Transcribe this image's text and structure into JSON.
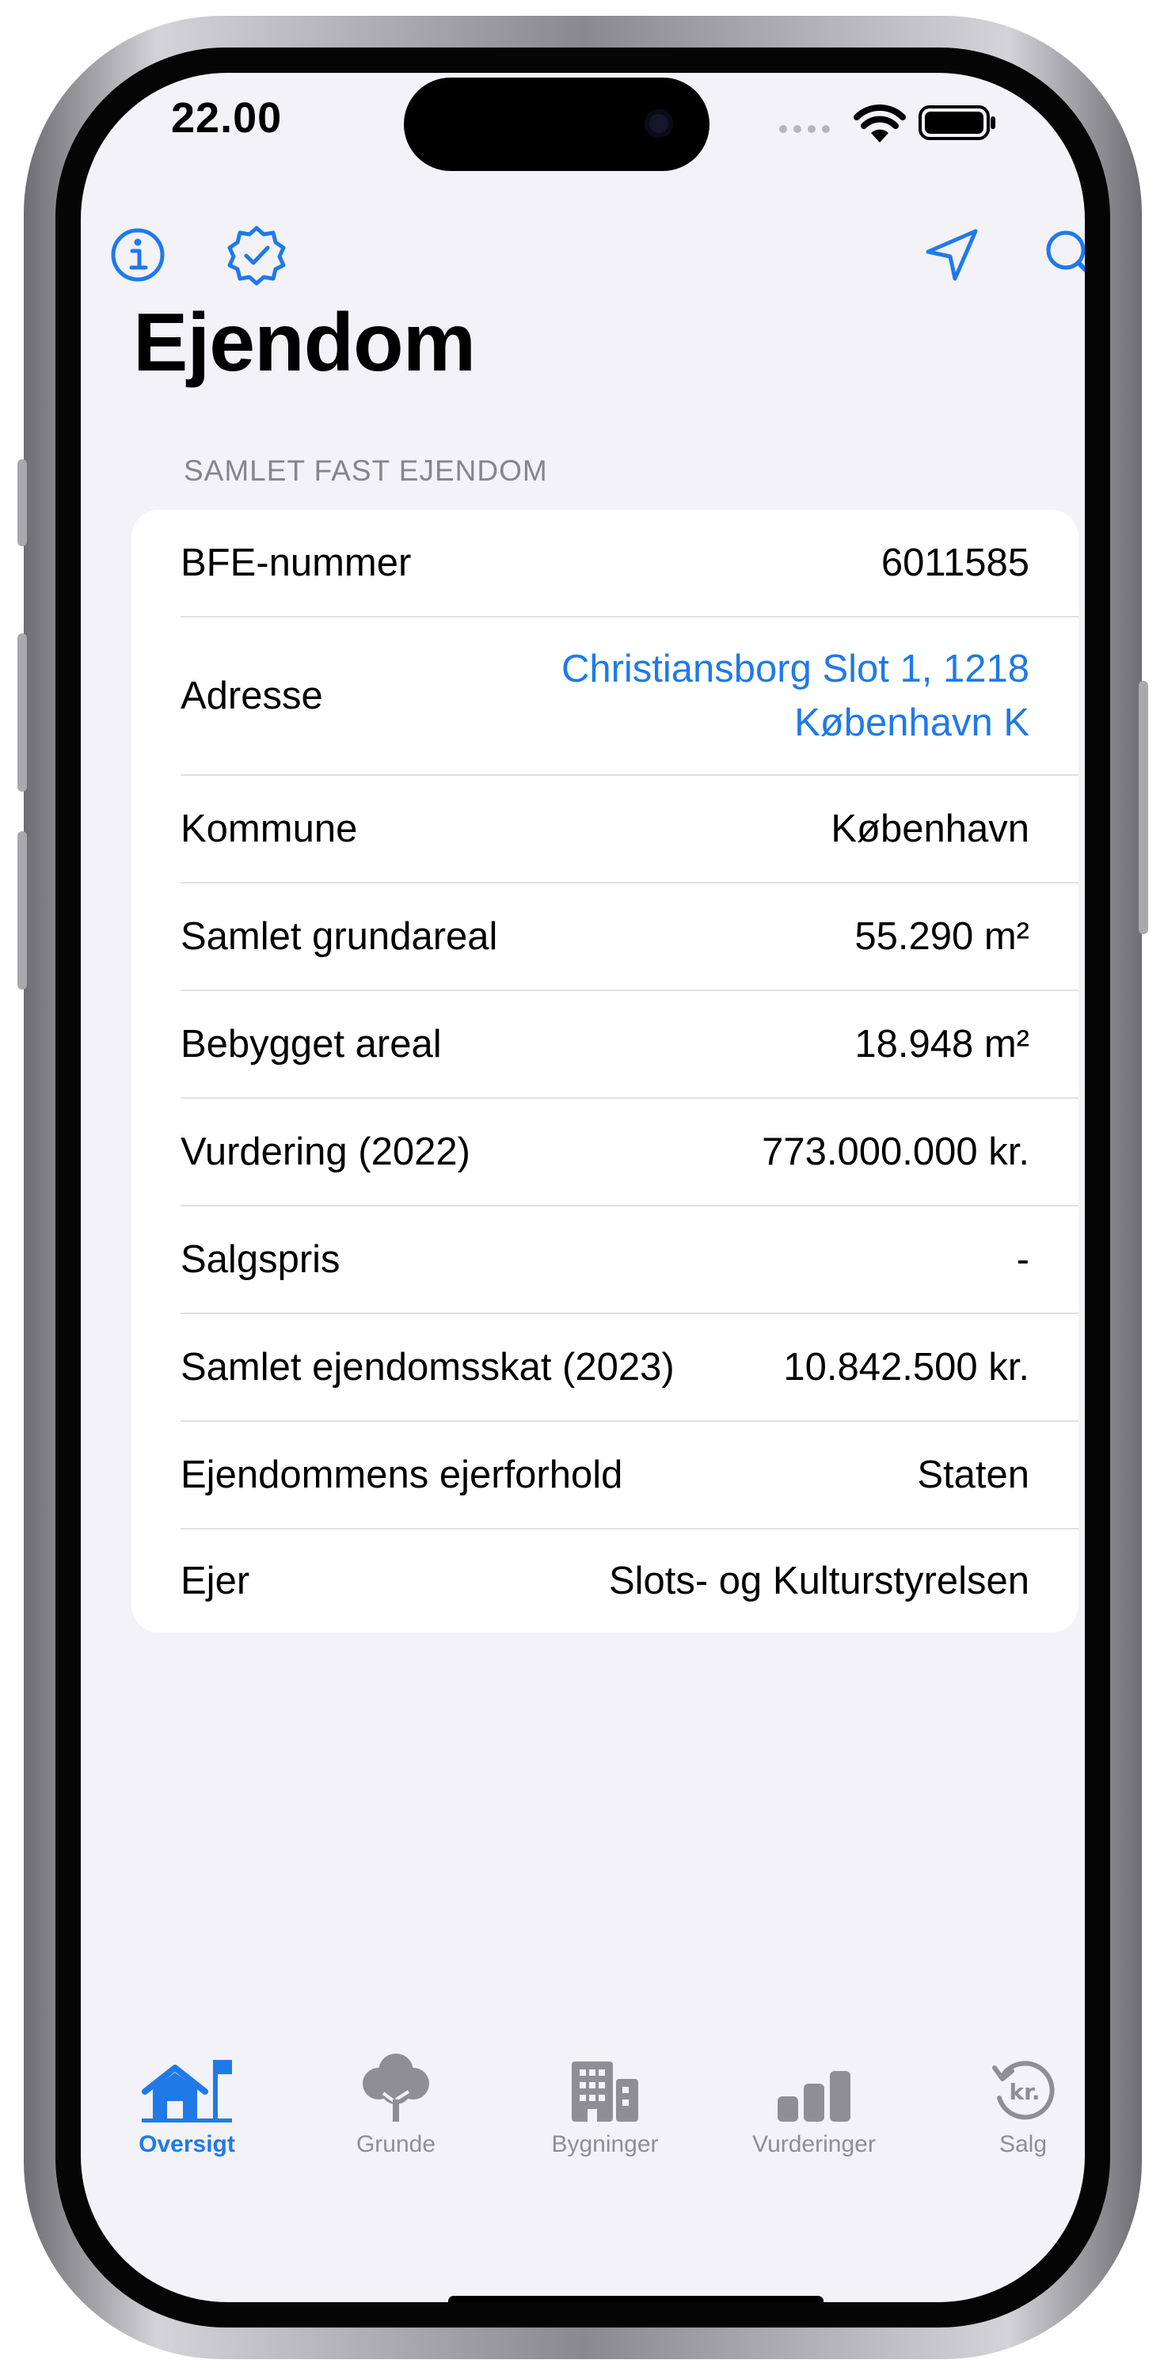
{
  "status_bar": {
    "time": "22.00"
  },
  "toolbar": {
    "left_icons": [
      "info-icon",
      "verified-badge-icon"
    ],
    "right_icons": [
      "location-arrow-icon",
      "search-icon"
    ]
  },
  "page": {
    "title": "Ejendom",
    "section_header": "SAMLET FAST EJENDOM"
  },
  "properties": [
    {
      "label": "BFE-nummer",
      "value": "6011585"
    },
    {
      "label": "Adresse",
      "value_line1": "Christiansborg Slot 1, 1218",
      "value_line2": "København K"
    },
    {
      "label": "Kommune",
      "value": "København"
    },
    {
      "label": "Samlet grundareal",
      "value": "55.290 m²"
    },
    {
      "label": "Bebygget areal",
      "value": "18.948 m²"
    },
    {
      "label": "Vurdering (2022)",
      "value": "773.000.000 kr."
    },
    {
      "label": "Salgspris",
      "value": "-"
    },
    {
      "label": "Samlet ejendomsskat (2023)",
      "value": "10.842.500 kr."
    },
    {
      "label": "Ejendommens ejerforhold",
      "value": "Staten"
    },
    {
      "label": "Ejer",
      "value": "Slots- og Kulturstyrelsen"
    }
  ],
  "tabs": [
    {
      "label": "Oversigt",
      "icon": "house-flag-icon",
      "active": true
    },
    {
      "label": "Grunde",
      "icon": "tree-icon",
      "active": false
    },
    {
      "label": "Bygninger",
      "icon": "buildings-icon",
      "active": false
    },
    {
      "label": "Vurderinger",
      "icon": "bar-chart-icon",
      "active": false
    },
    {
      "label": "Salg",
      "icon": "kr-history-icon",
      "active": false
    }
  ],
  "colors": {
    "accent": "#1f7ae8",
    "background": "#f2f2f7",
    "inactive_tab": "#8e8e93"
  }
}
